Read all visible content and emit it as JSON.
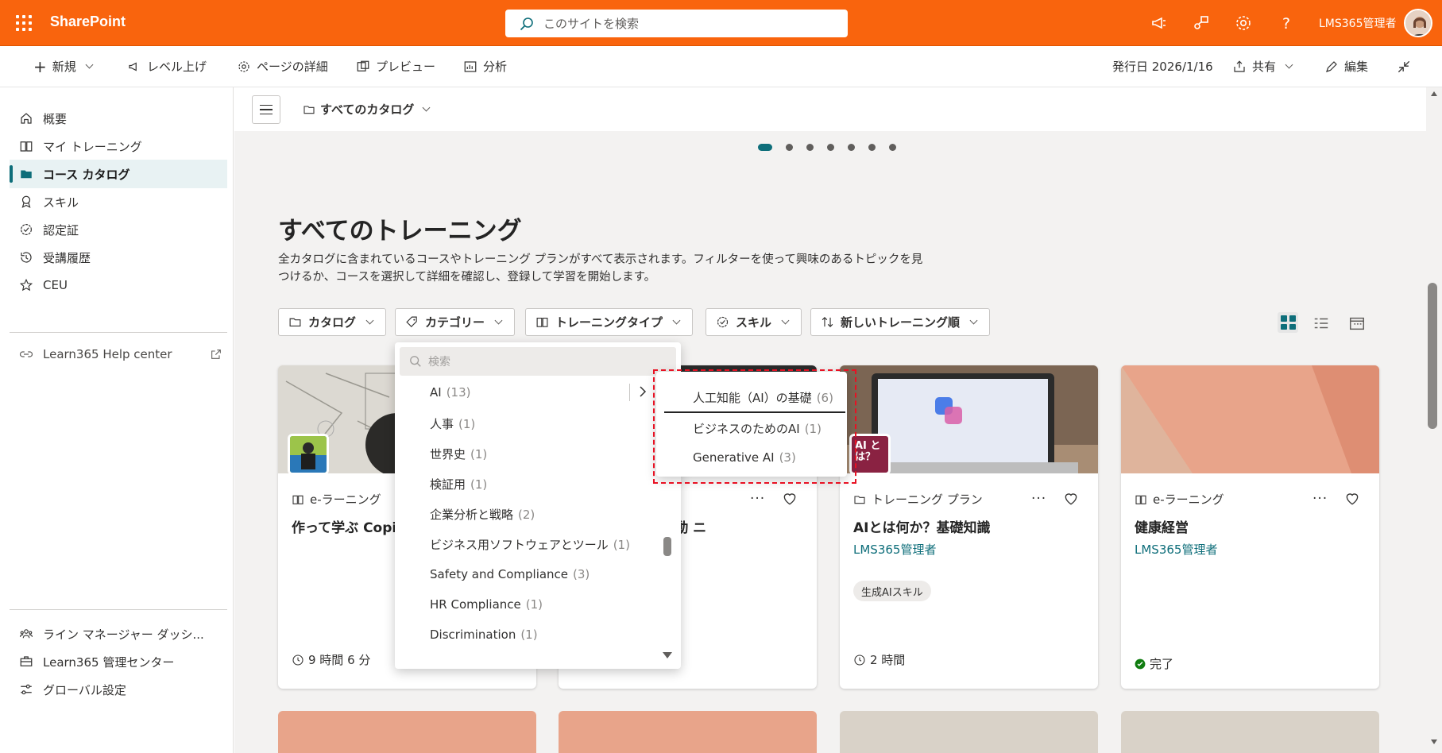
{
  "app": {
    "name": "SharePoint",
    "search_placeholder": "このサイトを検索",
    "user": "LMS365管理者"
  },
  "commands": {
    "new": "新規",
    "promote": "レベル上げ",
    "page_details": "ページの詳細",
    "preview": "プレビュー",
    "analytics": "分析",
    "published": "発行日 2026/1/16",
    "share": "共有",
    "edit": "編集"
  },
  "nav": {
    "items": [
      {
        "label": "概要",
        "icon": "home-icon"
      },
      {
        "label": "マイ トレーニング",
        "icon": "book-icon"
      },
      {
        "label": "コース カタログ",
        "icon": "folder-icon",
        "selected": true
      },
      {
        "label": "スキル",
        "icon": "ribbon-icon"
      },
      {
        "label": "認定証",
        "icon": "certificate-icon"
      },
      {
        "label": "受講履歴",
        "icon": "history-icon"
      },
      {
        "label": "CEU",
        "icon": "star-icon"
      }
    ],
    "help": "Learn365 Help center",
    "bottom": [
      {
        "label": "ライン マネージャー ダッシ...",
        "icon": "people-icon"
      },
      {
        "label": "Learn365 管理センター",
        "icon": "briefcase-icon"
      },
      {
        "label": "グローバル設定",
        "icon": "settings-sliders-icon"
      }
    ]
  },
  "main": {
    "breadcrumb": "すべてのカタログ",
    "title": "すべてのトレーニング",
    "description": "全カタログに含まれているコースやトレーニング プランがすべて表示されます。フィルターを使って興味のあるトピックを見つけるか、コースを選択して詳細を確認し、登録して学習を開始します。",
    "filters": {
      "catalog": "カタログ",
      "category": "カテゴリー",
      "training_type": "トレーニングタイプ",
      "skill": "スキル",
      "sort": "新しいトレーニング順"
    }
  },
  "cards": [
    {
      "type": "e-ラーニング",
      "title": "作って学ぶ Copi なAIエージェン",
      "author": "",
      "tag": "",
      "duration": "9 時間 6 分"
    },
    {
      "type": "",
      "title": "opilot 業務の自動 ニ",
      "author": "",
      "tag": "",
      "duration": ""
    },
    {
      "type": "トレーニング プラン",
      "title": "AIとは何か？基礎知識",
      "author": "LMS365管理者",
      "tag": "生成AIスキル",
      "duration": "2 時間",
      "badge": "AI とは？"
    },
    {
      "type": "e-ラーニング",
      "title": "健康経営",
      "author": "LMS365管理者",
      "tag": "",
      "duration": "完了"
    }
  ],
  "category_dropdown": {
    "search_placeholder": "検索",
    "items": [
      {
        "label": "AI",
        "count": "(13)"
      },
      {
        "label": "人事",
        "count": "(1)"
      },
      {
        "label": "世界史",
        "count": "(1)"
      },
      {
        "label": "検証用",
        "count": "(1)"
      },
      {
        "label": "企業分析と戦略",
        "count": "(2)"
      },
      {
        "label": "ビジネス用ソフトウェアとツール",
        "count": "(1)"
      },
      {
        "label": "Safety and Compliance",
        "count": "(3)"
      },
      {
        "label": "HR Compliance",
        "count": "(1)"
      },
      {
        "label": "Discrimination",
        "count": "(1)"
      }
    ],
    "sub_items": [
      {
        "label": "人工知能（AI）の基礎",
        "count": "(6)"
      },
      {
        "label": "ビジネスのためのAI",
        "count": "(1)"
      },
      {
        "label": "Generative AI",
        "count": "(3)"
      }
    ]
  },
  "colors": {
    "brand": "#f9640d",
    "accent": "#0e6e7a",
    "highlight": "#e81123"
  }
}
